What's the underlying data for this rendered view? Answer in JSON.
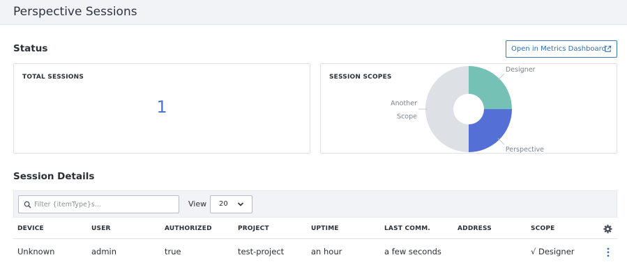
{
  "page": {
    "title": "Perspective Sessions"
  },
  "status": {
    "title": "Status",
    "metrics_button": "Open in Metrics Dashboard",
    "total_sessions": {
      "title": "TOTAL SESSIONS",
      "value": "1"
    },
    "session_scopes": {
      "title": "SESSION SCOPES",
      "chart_data": {
        "type": "pie",
        "donut": true,
        "slices": [
          {
            "label": "Designer",
            "value": 25,
            "color": "#76c1b5"
          },
          {
            "label": "Perspective",
            "value": 25,
            "color": "#5470d6"
          },
          {
            "label": "Another Scope",
            "label_lines": [
              "Another",
              "Scope"
            ],
            "value": 50,
            "color": "#dde0e5"
          }
        ]
      }
    }
  },
  "details": {
    "title": "Session Details",
    "filter_placeholder": "Filter {itemType}s...",
    "view_label": "View",
    "view_value": "20",
    "columns": [
      "DEVICE",
      "USER",
      "AUTHORIZED",
      "PROJECT",
      "UPTIME",
      "LAST COMM.",
      "ADDRESS",
      "SCOPE"
    ],
    "rows": [
      {
        "device": "Unknown",
        "user": "admin",
        "authorized": "true",
        "project": "test-project",
        "uptime": "an hour",
        "last_comm": "a few seconds",
        "address": "",
        "scope": "√ Designer"
      }
    ]
  },
  "icons": {
    "external_link": "external-link-icon",
    "search": "search-icon",
    "chevron": "chevron-down-icon",
    "settings": "gear-icon",
    "row_menu": "kebab-menu-icon"
  },
  "colors": {
    "accent": "#3d7ab8",
    "number": "#4a76c6",
    "header_bg": "#f1f3f6"
  }
}
